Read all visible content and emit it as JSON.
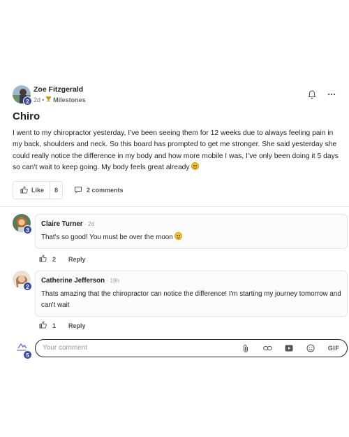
{
  "post": {
    "author": "Zoe Fitzgerald",
    "author_badge": "2",
    "time": "2d",
    "separator": "•",
    "group": "Milestones",
    "title": "Chiro",
    "body": "I went to my chiropractor yesterday, I’ve been seeing them for 12 weeks due to always feeling pain in my back, shoulders and neck. So this board has prompted to get me stronger. She said yesterday she could really notice the difference in my body and how more mobile I was, I’ve only been doing it 5 days so can’t wait to keep going. My body feels great already",
    "like_label": "Like",
    "like_count": "8",
    "comments_label": "2 comments"
  },
  "comments": [
    {
      "author": "Claire Turner",
      "time": "2d",
      "badge": "3",
      "text": "That's so good! You must be over the moon",
      "likes": "2",
      "reply_label": "Reply"
    },
    {
      "author": "Catherine Jefferson",
      "time": "19h",
      "badge": "2",
      "text": "Thats amazing that the chiropractor can notice the difference! I'm starting my journey tomorrow and can't wait",
      "likes": "1",
      "reply_label": "Reply"
    }
  ],
  "composer": {
    "placeholder": "Your comment",
    "avatar_badge": "5",
    "gif_label": "GIF"
  },
  "colors": {
    "badge": "#3b4aa8",
    "border": "#e6e6e6",
    "muted_text": "#777777"
  },
  "icons": {
    "bell": "bell-icon",
    "more": "more-icon",
    "like": "thumbs-up-icon",
    "comment": "comment-icon",
    "attach": "paperclip-icon",
    "link": "link-icon",
    "video": "video-icon",
    "emoji": "emoji-icon",
    "trophy": "trophy-icon"
  }
}
